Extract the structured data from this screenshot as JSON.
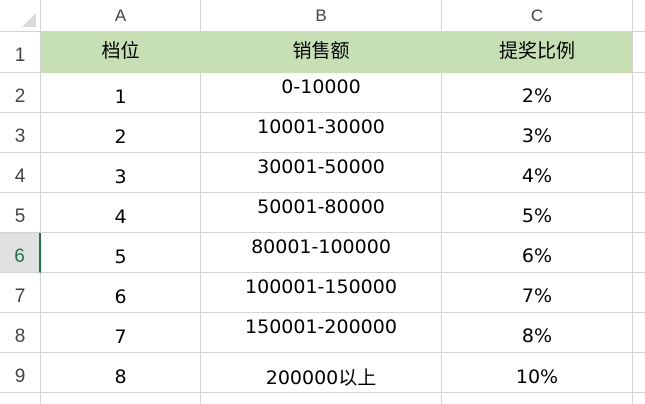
{
  "columns": [
    "A",
    "B",
    "C"
  ],
  "rows": [
    "1",
    "2",
    "3",
    "4",
    "5",
    "6",
    "7",
    "8",
    "9"
  ],
  "active_row": "6",
  "header_fill_color": "#c6e0b4",
  "active_row_color": "#217346",
  "table": {
    "headers": [
      "档位",
      "销售额",
      "提奖比例"
    ],
    "data": [
      [
        "1",
        "0-10000",
        "2%"
      ],
      [
        "2",
        "10001-30000",
        "3%"
      ],
      [
        "3",
        "30001-50000",
        "4%"
      ],
      [
        "4",
        "50001-80000",
        "5%"
      ],
      [
        "5",
        "80001-100000",
        "6%"
      ],
      [
        "6",
        "100001-150000",
        "7%"
      ],
      [
        "7",
        "150001-200000",
        "8%"
      ],
      [
        "8",
        "200000以上",
        "10%"
      ]
    ]
  }
}
